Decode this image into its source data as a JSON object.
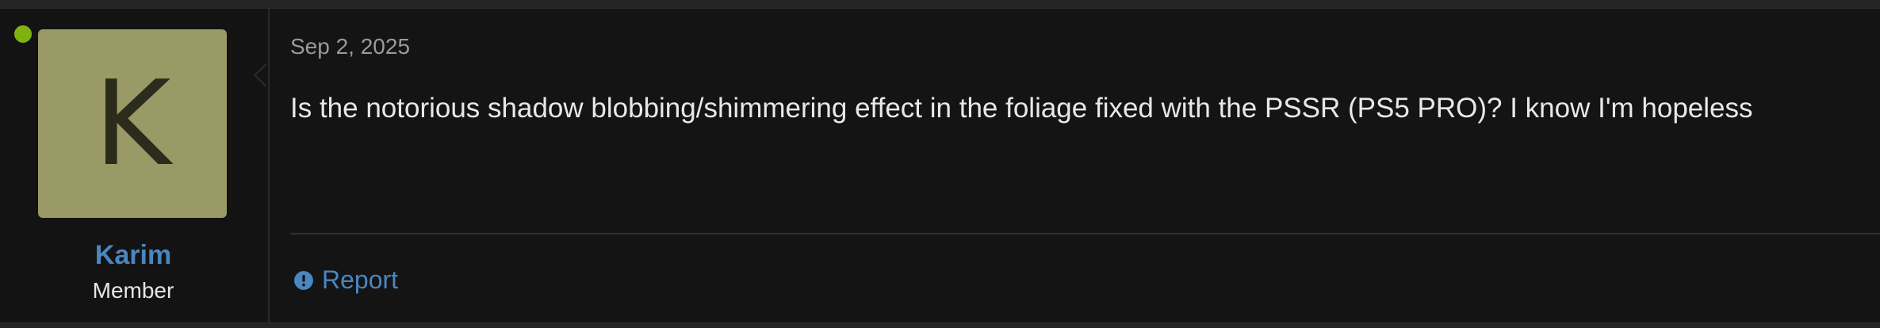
{
  "post": {
    "user": {
      "avatar_letter": "K",
      "name": "Karim",
      "title": "Member",
      "online_indicator_color": "#7fb210",
      "avatar_color": "#9a9a67"
    },
    "date": "Sep 2, 2025",
    "body": "Is the notorious shadow blobbing/shimmering effect in the foliage fixed with the PSSR (PS5 PRO)? I know I'm hopeless",
    "actions": {
      "report_label": "Report",
      "report_icon": "exclamation-circle-icon"
    },
    "link_color": "#4a86c0"
  }
}
